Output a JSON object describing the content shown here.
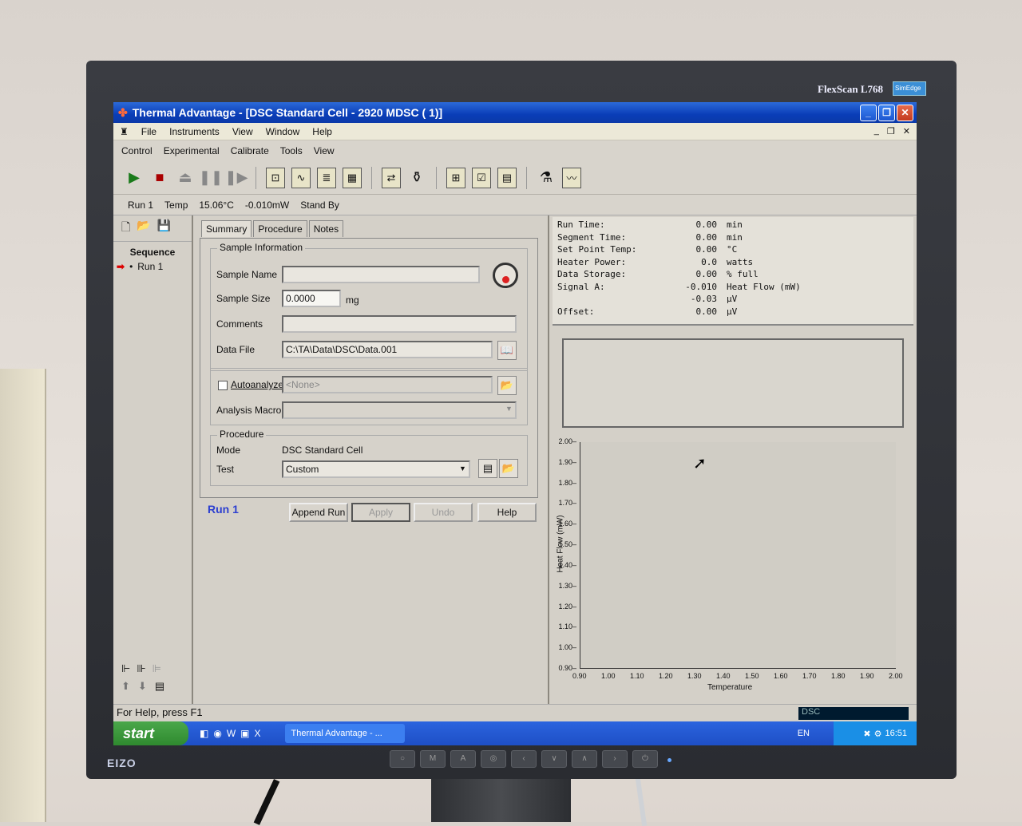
{
  "monitor": {
    "brand": "FlexScan L768",
    "badge": "SimEdge",
    "logo": "EIZO"
  },
  "window": {
    "title": "Thermal Advantage - [DSC Standard Cell - 2920 MDSC ( 1)]"
  },
  "menu": [
    "File",
    "Instruments",
    "View",
    "Window",
    "Help"
  ],
  "menu2": [
    "Control",
    "Experimental",
    "Calibrate",
    "Tools",
    "View"
  ],
  "status": {
    "run": "Run 1",
    "temp_label": "Temp",
    "temp_value": "15.06°C",
    "power": "-0.010mW",
    "state": "Stand By"
  },
  "sequence": {
    "title": "Sequence",
    "run": "Run 1"
  },
  "tabs": [
    "Summary",
    "Procedure",
    "Notes"
  ],
  "sample_info": {
    "group_label": "Sample Information",
    "name_label": "Sample Name",
    "name_value": "",
    "size_label": "Sample Size",
    "size_value": "0.0000",
    "size_unit": "mg",
    "comments_label": "Comments",
    "comments_value": "",
    "datafile_label": "Data File",
    "datafile_value": "C:\\TA\\Data\\DSC\\Data.001"
  },
  "analysis": {
    "autoanalyze_label": "Autoanalyze",
    "autoanalyze_value": "<None>",
    "macro_label": "Analysis Macro",
    "macro_value": ""
  },
  "procedure": {
    "group_label": "Procedure",
    "mode_label": "Mode",
    "mode_value": "DSC Standard Cell",
    "test_label": "Test",
    "test_value": "Custom"
  },
  "actions": {
    "run_label": "Run 1",
    "append": "Append Run",
    "apply": "Apply",
    "undo": "Undo",
    "help": "Help"
  },
  "readout": [
    {
      "label": "Run Time:",
      "value": "0.00",
      "unit": "min"
    },
    {
      "label": "Segment Time:",
      "value": "0.00",
      "unit": "min"
    },
    {
      "label": "Set Point Temp:",
      "value": "0.00",
      "unit": "°C"
    },
    {
      "label": "Heater Power:",
      "value": "0.0",
      "unit": "watts"
    },
    {
      "label": "Data Storage:",
      "value": "0.00",
      "unit": "% full"
    },
    {
      "label": "Signal A:",
      "value": "-0.010",
      "unit": "Heat Flow (mW)"
    },
    {
      "label": "",
      "value": "-0.03",
      "unit": "µV"
    },
    {
      "label": "Offset:",
      "value": "0.00",
      "unit": "µV"
    }
  ],
  "chart_data": {
    "type": "line",
    "xlabel": "Temperature",
    "ylabel": "Heat Flow (mW)",
    "xlim": [
      0.9,
      2.0
    ],
    "ylim": [
      0.9,
      2.0
    ],
    "xticks": [
      "0.90",
      "1.00",
      "1.10",
      "1.20",
      "1.30",
      "1.40",
      "1.50",
      "1.60",
      "1.70",
      "1.80",
      "1.90",
      "2.00"
    ],
    "yticks": [
      "2.00",
      "1.90",
      "1.80",
      "1.70",
      "1.60",
      "1.50",
      "1.40",
      "1.30",
      "1.20",
      "1.10",
      "1.00",
      "0.90"
    ],
    "series": []
  },
  "helpbar": {
    "text": "For Help, press F1",
    "instrument": "DSC"
  },
  "taskbar": {
    "start": "start",
    "task": "Thermal Advantage - ...",
    "lang": "EN",
    "clock": "16:51"
  }
}
